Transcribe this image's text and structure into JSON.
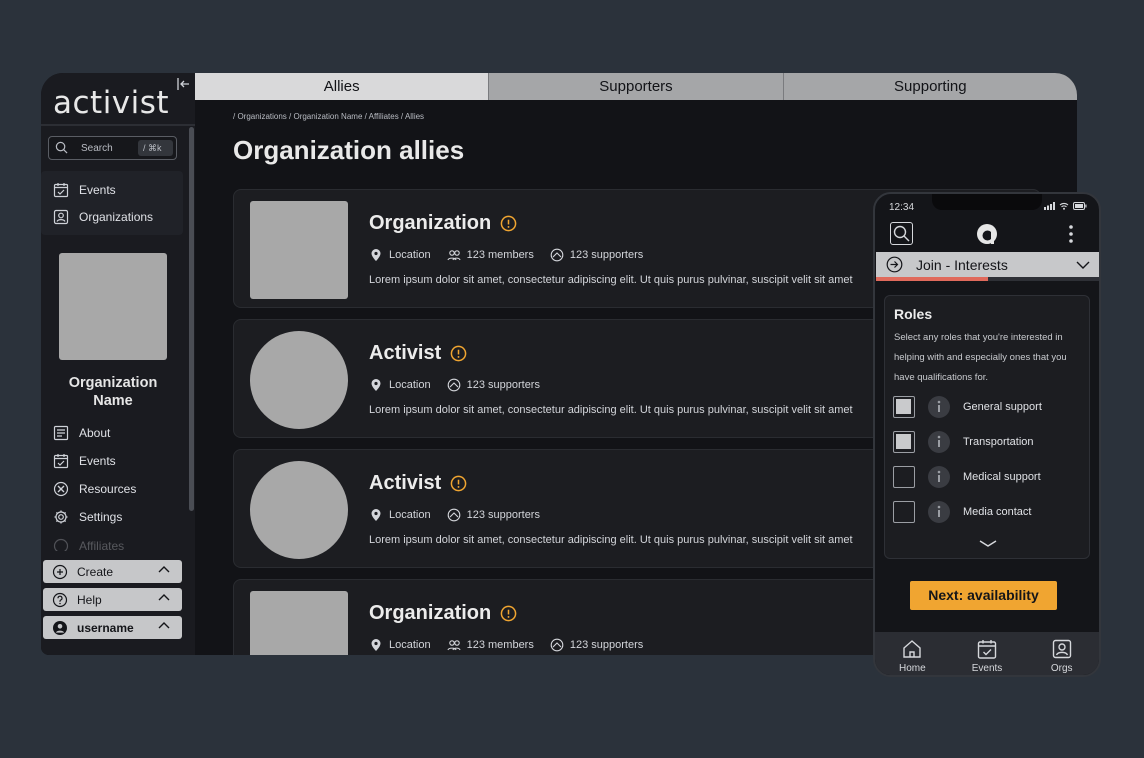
{
  "app": {
    "logo": "activist"
  },
  "sidebar": {
    "search_label": "Search",
    "search_shortcut": "/  ⌘k",
    "top_nav": [
      {
        "label": "Events",
        "icon": "calendar-check-icon"
      },
      {
        "label": "Organizations",
        "icon": "people-card-icon"
      }
    ],
    "org_name": "Organization Name",
    "org_nav": [
      {
        "label": "About",
        "icon": "document-icon"
      },
      {
        "label": "Events",
        "icon": "calendar-check-icon"
      },
      {
        "label": "Resources",
        "icon": "tools-icon"
      },
      {
        "label": "Settings",
        "icon": "gear-icon"
      },
      {
        "label": "Affiliates",
        "icon": "handshake-icon"
      }
    ],
    "bottom": [
      {
        "label": "Create",
        "icon": "plus-circle-icon"
      },
      {
        "label": "Help",
        "icon": "question-circle-icon"
      },
      {
        "label": "username",
        "icon": "user-avatar-icon"
      }
    ]
  },
  "tabs": [
    {
      "label": "Allies",
      "active": true
    },
    {
      "label": "Supporters",
      "active": false
    },
    {
      "label": "Supporting",
      "active": false
    }
  ],
  "breadcrumb": "/ Organizations / Organization Name / Affiliates / Allies",
  "page_title": "Organization allies",
  "cards": [
    {
      "type": "organization",
      "title": "Organization",
      "location": "Location",
      "members": "123 members",
      "supporters": "123 supporters",
      "description": "Lorem ipsum dolor sit amet, consectetur adipiscing elit. Ut quis purus pulvinar, suscipit velit sit amet"
    },
    {
      "type": "activist",
      "title": "Activist",
      "location": "Location",
      "supporters": "123 supporters",
      "description": "Lorem ipsum dolor sit amet, consectetur adipiscing elit. Ut quis purus pulvinar, suscipit velit sit amet"
    },
    {
      "type": "activist",
      "title": "Activist",
      "location": "Location",
      "supporters": "123 supporters",
      "description": "Lorem ipsum dolor sit amet, consectetur adipiscing elit. Ut quis purus pulvinar, suscipit velit sit amet"
    },
    {
      "type": "organization",
      "title": "Organization",
      "location": "Location",
      "members": "123 members",
      "supporters": "123 supporters"
    }
  ],
  "phone": {
    "time": "12:34",
    "join_label": "Join - Interests",
    "progress": 0.5,
    "roles_title": "Roles",
    "roles_desc": "Select any roles that you're interested in helping with and especially ones that you have qualifications for.",
    "roles": [
      {
        "label": "General support",
        "checked": true
      },
      {
        "label": "Transportation",
        "checked": true
      },
      {
        "label": "Medical support",
        "checked": false
      },
      {
        "label": "Media contact",
        "checked": false
      }
    ],
    "next_label": "Next: availability",
    "bottom_tabs": [
      {
        "label": "Home",
        "icon": "home-icon"
      },
      {
        "label": "Events",
        "icon": "calendar-check-icon"
      },
      {
        "label": "Orgs",
        "icon": "people-card-icon"
      }
    ]
  },
  "colors": {
    "accent": "#f0a531",
    "progress": "#e06a5c",
    "background": "#2b323b"
  }
}
